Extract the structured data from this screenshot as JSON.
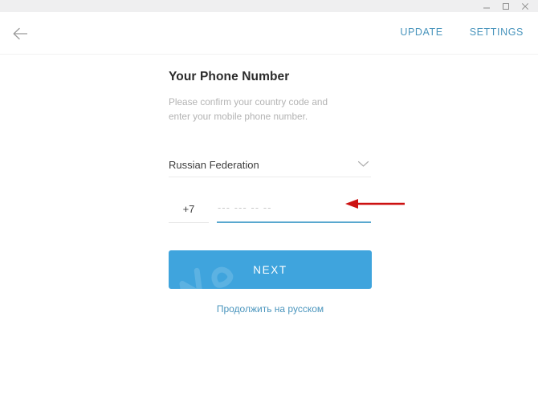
{
  "window": {
    "minimize_label": "minimize",
    "maximize_label": "maximize",
    "close_label": "close"
  },
  "header": {
    "back_label": "back",
    "update_label": "UPDATE",
    "settings_label": "SETTINGS",
    "link_color": "#4a95bd"
  },
  "form": {
    "title": "Your Phone Number",
    "subtitle": "Please confirm your country code and enter your mobile phone number.",
    "country": {
      "selected": "Russian Federation",
      "chevron": "chevron-down-icon"
    },
    "phone": {
      "country_code": "+7",
      "placeholder": "--- --- -- --",
      "value": "",
      "focus_color": "#59a8cf"
    },
    "next_label": "NEXT",
    "next_color": "#3fa4dd",
    "alt_language_link": "Продолжить на русском"
  },
  "annotation": {
    "arrow_label": "red-pointer-arrow",
    "arrow_color": "#cc1111"
  }
}
